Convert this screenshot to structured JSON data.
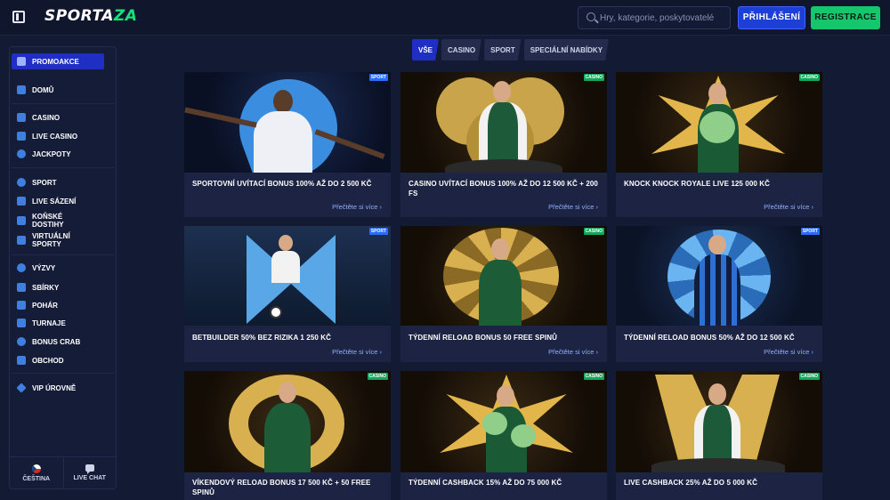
{
  "header": {
    "logo_main": "SPORTA",
    "logo_accent": "ZA",
    "search_placeholder": "Hry, kategorie, poskytovatelé",
    "login_label": "PŘIHLÁŠENÍ",
    "register_label": "REGISTRACE"
  },
  "sidebar": {
    "items": [
      {
        "label": "PROMOAKCE",
        "icon": "gift-icon",
        "active": true
      },
      {
        "label": "DOMŮ",
        "icon": "home-icon"
      },
      {
        "label": "CASINO",
        "icon": "slot-machine-icon"
      },
      {
        "label": "LIVE CASINO",
        "icon": "live-casino-icon"
      },
      {
        "label": "JACKPOTY",
        "icon": "jackpot-icon"
      },
      {
        "label": "SPORT",
        "icon": "soccer-ball-icon"
      },
      {
        "label": "LIVE SÁZENÍ",
        "icon": "live-betting-icon"
      },
      {
        "label": "KOŇSKÉ DOSTIHY",
        "icon": "horse-icon"
      },
      {
        "label": "VIRTUÁLNÍ SPORTY",
        "icon": "virtual-sports-icon"
      },
      {
        "label": "VÝZVY",
        "icon": "challenge-icon"
      },
      {
        "label": "SBÍRKY",
        "icon": "collection-icon"
      },
      {
        "label": "POHÁR",
        "icon": "trophy-icon"
      },
      {
        "label": "TURNAJE",
        "icon": "tournament-icon"
      },
      {
        "label": "BONUS CRAB",
        "icon": "crab-icon"
      },
      {
        "label": "OBCHOD",
        "icon": "shop-icon"
      },
      {
        "label": "VIP ÚROVNĚ",
        "icon": "diamond-icon"
      }
    ],
    "language_label": "ČEŠTINA",
    "live_chat_label": "LIVE CHAT"
  },
  "tabs": [
    {
      "label": "VŠE",
      "active": true
    },
    {
      "label": "CASINO"
    },
    {
      "label": "SPORT"
    },
    {
      "label": "SPECIÁLNÍ NABÍDKY"
    }
  ],
  "promos": [
    {
      "title": "SPORTOVNÍ UVÍTACÍ BONUS 100% AŽ DO 2 500 KČ",
      "badge": "SPORT",
      "link": "Přečtěte si více"
    },
    {
      "title": "CASINO UVÍTACÍ BONUS 100% AŽ DO 12 500 KČ + 200 FS",
      "badge": "CASINO",
      "link": "Přečtěte si více"
    },
    {
      "title": "KNOCK KNOCK ROYALE LIVE 125 000 KČ",
      "badge": "CASINO",
      "link": "Přečtěte si více"
    },
    {
      "title": "BETBUILDER 50% BEZ RIZIKA 1 250 KČ",
      "badge": "SPORT",
      "link": "Přečtěte si více"
    },
    {
      "title": "TÝDENNÍ RELOAD BONUS 50 FREE SPINŮ",
      "badge": "CASINO",
      "link": "Přečtěte si více"
    },
    {
      "title": "TÝDENNÍ RELOAD BONUS 50% AŽ DO 12 500 KČ",
      "badge": "SPORT",
      "link": "Přečtěte si více"
    },
    {
      "title": "VÍKENDOVÝ RELOAD BONUS 17 500 KČ + 50 FREE SPINŮ",
      "badge": "CASINO",
      "link": ""
    },
    {
      "title": "TÝDENNÍ CASHBACK 15% AŽ DO 75 000 KČ",
      "badge": "CASINO",
      "link": ""
    },
    {
      "title": "LIVE CASHBACK 25% AŽ DO 5 000 KČ",
      "badge": "CASINO",
      "link": ""
    }
  ],
  "colors": {
    "background": "#131a33",
    "accent_blue": "#1f2fc4",
    "accent_green": "#15c66d",
    "link": "#8fb1ff"
  }
}
